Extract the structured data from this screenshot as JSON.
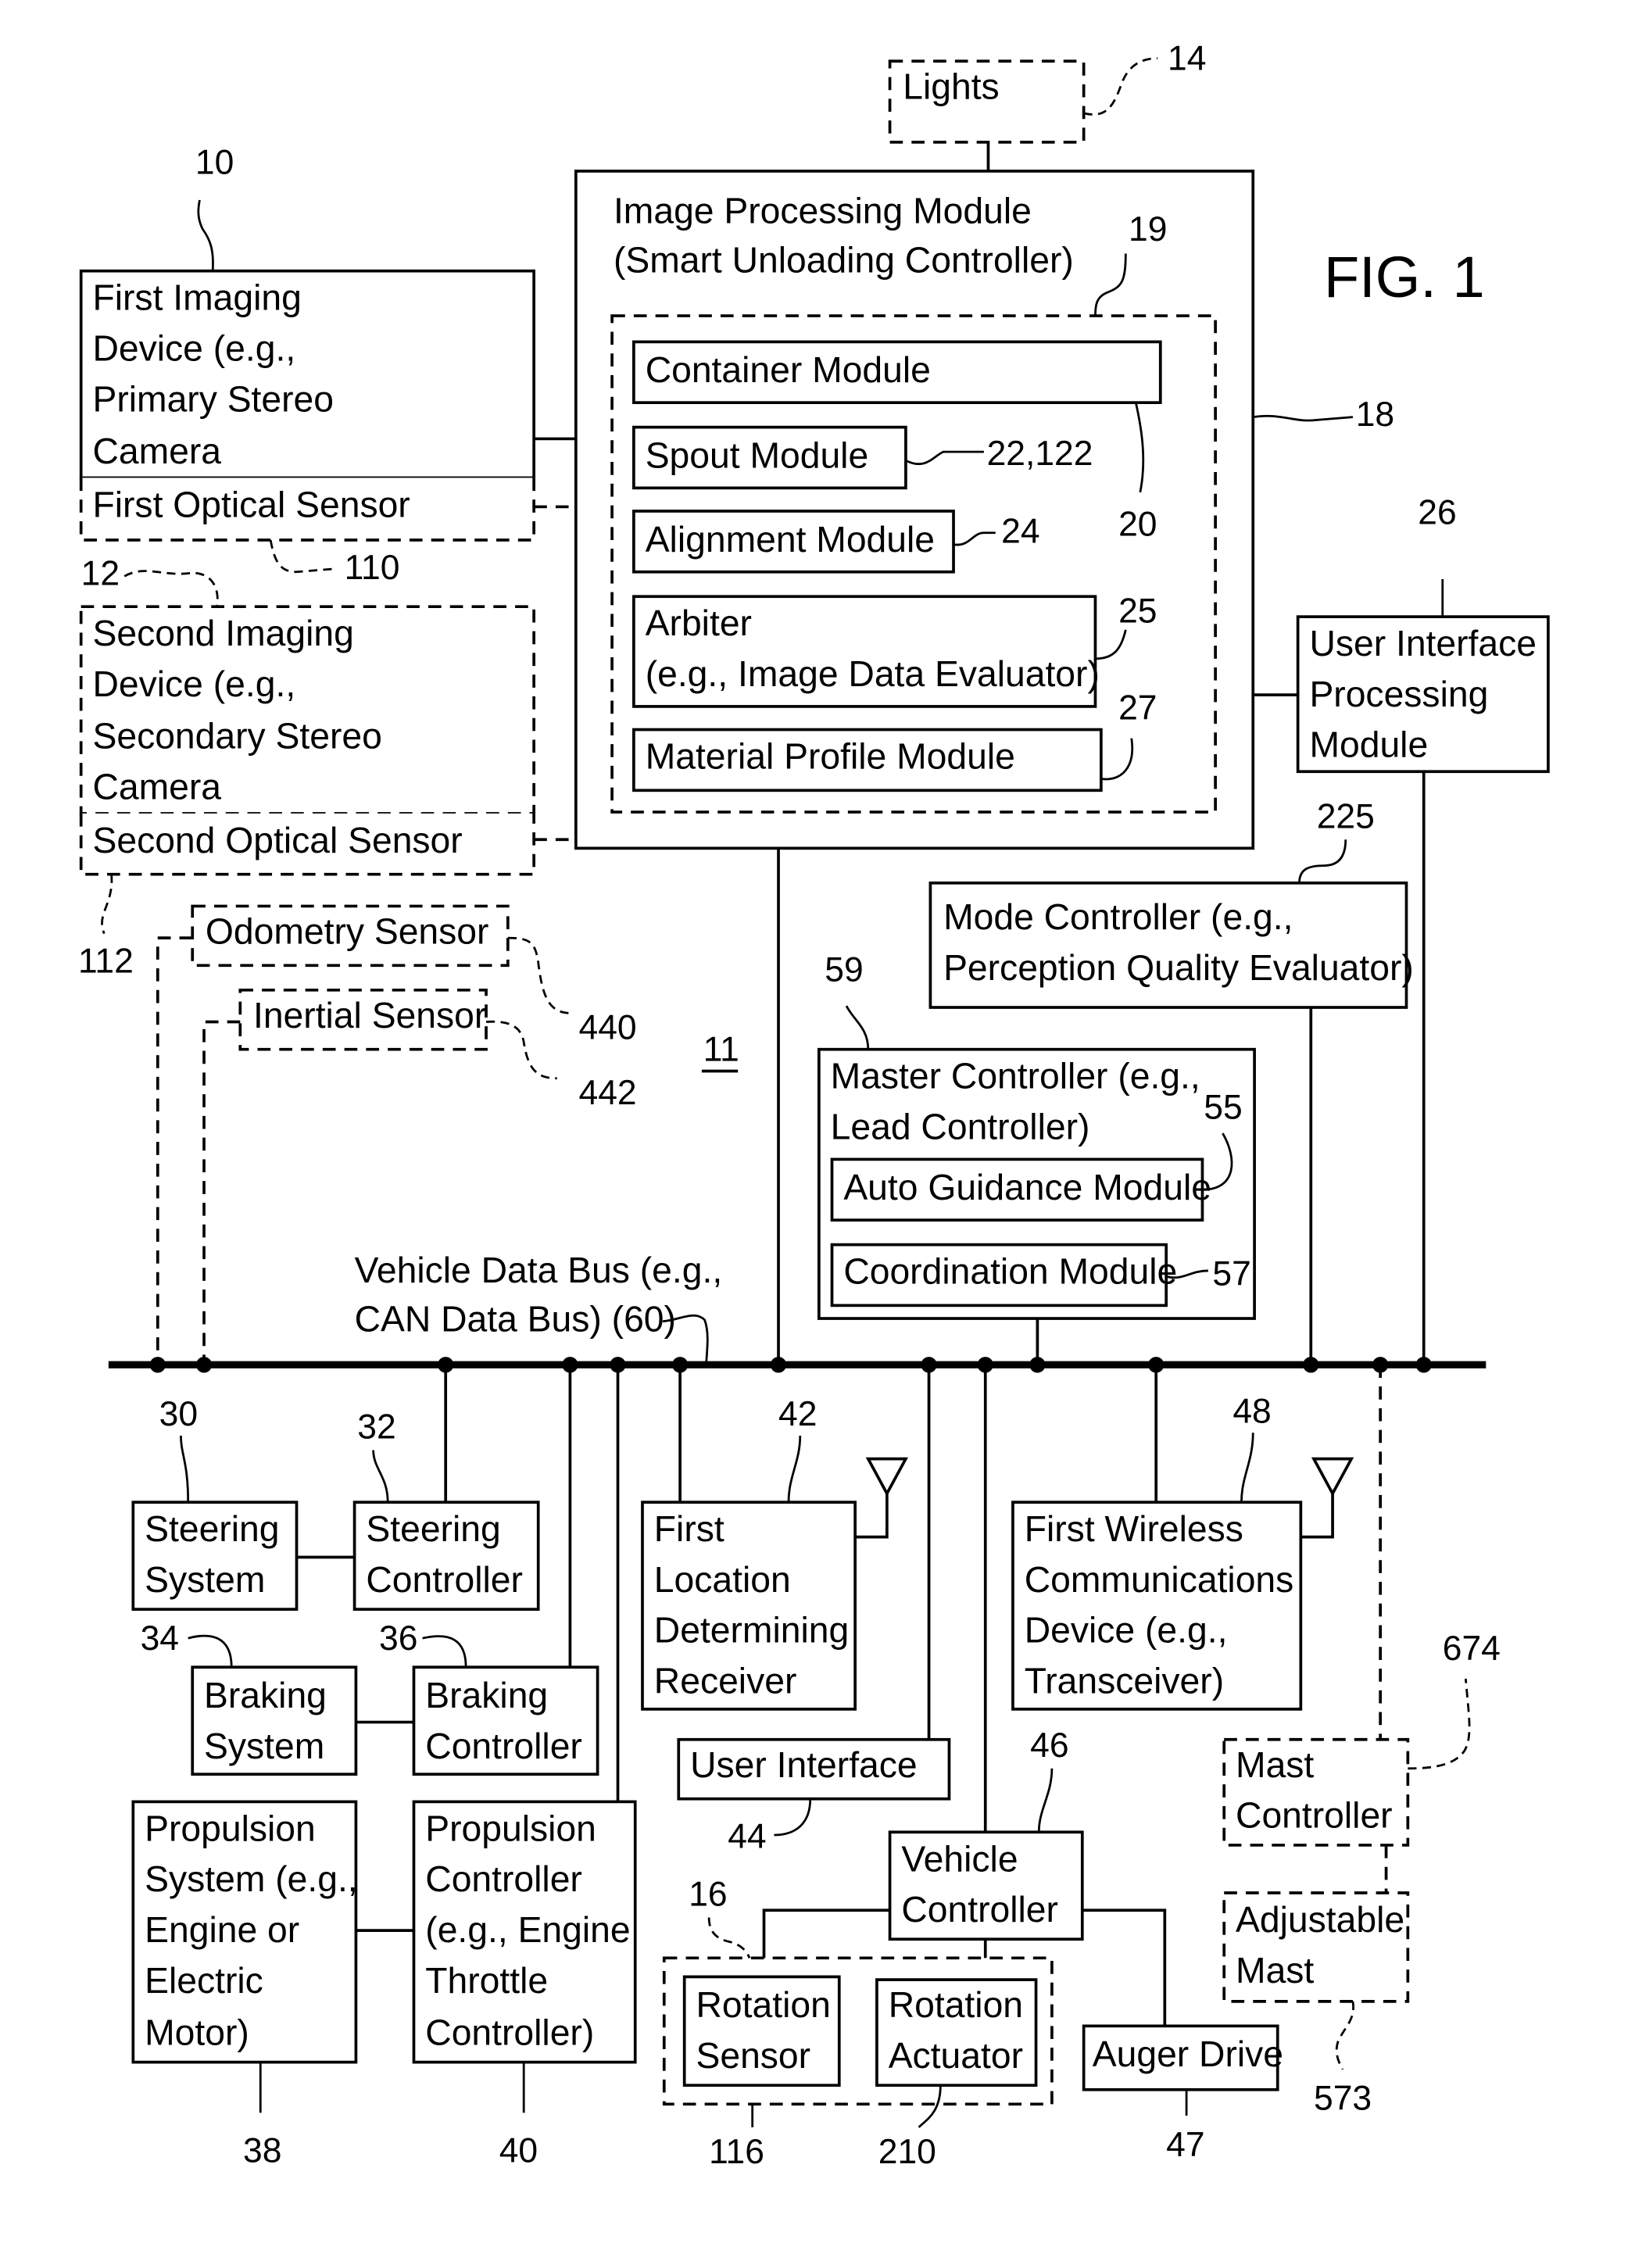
{
  "figure_title": "FIG. 1",
  "system_ref": "11",
  "lights": {
    "label": "Lights",
    "ref": "14"
  },
  "image_processing": {
    "title_line1": "Image Processing Module",
    "title_line2": "(Smart Unloading Controller)",
    "ref": "18",
    "group_ref": "19",
    "modules": [
      {
        "label": "Container Module",
        "ref": "20"
      },
      {
        "label": "Spout Module",
        "ref": "22,122"
      },
      {
        "label": "Alignment Module",
        "ref": "24"
      },
      {
        "label_line1": "Arbiter",
        "label_line2": "(e.g., Image Data Evaluator)",
        "ref": "25"
      },
      {
        "label": "Material Profile Module",
        "ref": "27"
      }
    ]
  },
  "first_imaging": {
    "lines": [
      "First Imaging",
      "Device (e.g.,",
      "Primary Stereo",
      "Camera"
    ],
    "ref": "10",
    "sensor_label": "First Optical Sensor",
    "sensor_ref": "110"
  },
  "second_imaging": {
    "lines": [
      "Second Imaging",
      "Device (e.g.,",
      "Secondary Stereo",
      "Camera"
    ],
    "ref": "12",
    "sensor_label": "Second Optical Sensor",
    "sensor_ref": "112"
  },
  "ui_processing": {
    "lines": [
      "User Interface",
      "Processing",
      "Module"
    ],
    "ref": "26"
  },
  "mode_controller": {
    "lines": [
      "Mode Controller (e.g.,",
      "Perception Quality Evaluator)"
    ],
    "ref": "225"
  },
  "odometry": {
    "label": "Odometry Sensor",
    "ref": "440"
  },
  "inertial": {
    "label": "Inertial Sensor",
    "ref": "442"
  },
  "master_controller": {
    "lines": [
      "Master Controller (e.g.,",
      "Lead Controller)"
    ],
    "ref": "59",
    "auto_guidance": {
      "label": "Auto Guidance Module",
      "ref": "55"
    },
    "coordination": {
      "label": "Coordination Module",
      "ref": "57"
    }
  },
  "bus": {
    "lines": [
      "Vehicle Data Bus (e.g.,",
      "CAN Data Bus) (60)"
    ]
  },
  "steering_system": {
    "lines": [
      "Steering",
      "System"
    ],
    "ref": "30"
  },
  "steering_controller": {
    "lines": [
      "Steering",
      "Controller"
    ],
    "ref": "32"
  },
  "braking_system": {
    "lines": [
      "Braking",
      "System"
    ],
    "ref": "34"
  },
  "braking_controller": {
    "lines": [
      "Braking",
      "Controller"
    ],
    "ref": "36"
  },
  "propulsion_system": {
    "lines": [
      "Propulsion",
      "System (e.g.,",
      "Engine or",
      "Electric",
      "Motor)"
    ],
    "ref": "38"
  },
  "propulsion_controller": {
    "lines": [
      "Propulsion",
      "Controller",
      "(e.g., Engine",
      "Throttle",
      "Controller)"
    ],
    "ref": "40"
  },
  "location_receiver": {
    "lines": [
      "First",
      "Location",
      "Determining",
      "Receiver"
    ],
    "ref": "42"
  },
  "user_interface": {
    "label": "User Interface",
    "ref": "44"
  },
  "wireless": {
    "lines": [
      "First Wireless",
      "Communications",
      "Device (e.g.,",
      "Transceiver)"
    ],
    "ref": "48"
  },
  "vehicle_controller": {
    "lines": [
      "Vehicle",
      "Controller"
    ],
    "ref": "46"
  },
  "rotation_group_ref": "16",
  "rotation_sensor": {
    "lines": [
      "Rotation",
      "Sensor"
    ],
    "ref": "116"
  },
  "rotation_actuator": {
    "lines": [
      "Rotation",
      "Actuator"
    ],
    "ref": "210"
  },
  "auger_drive": {
    "label": "Auger Drive",
    "ref": "47"
  },
  "mast_controller": {
    "lines": [
      "Mast",
      "Controller"
    ],
    "ref": "674"
  },
  "adjustable_mast": {
    "lines": [
      "Adjustable",
      "Mast"
    ],
    "ref": "573"
  }
}
